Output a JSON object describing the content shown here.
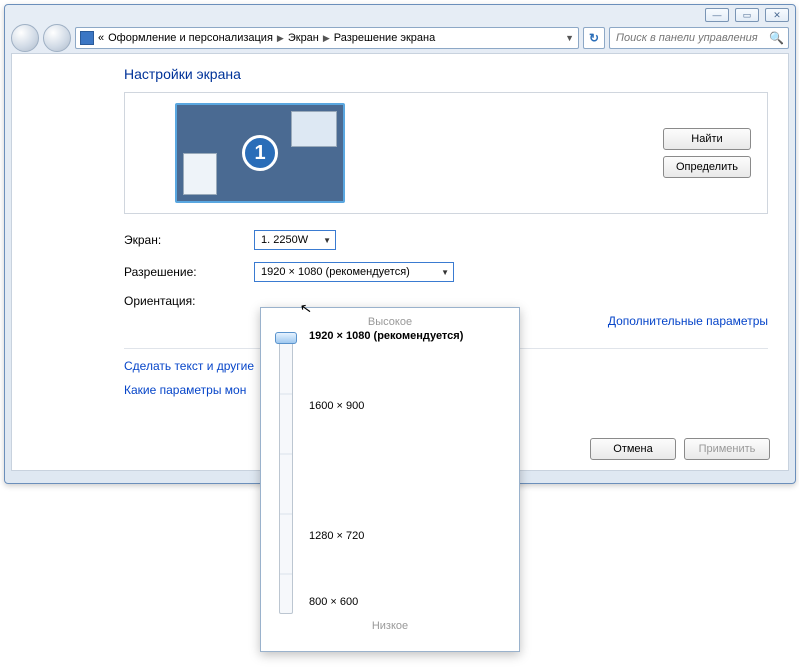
{
  "window": {
    "breadcrumb_prefix": "«",
    "breadcrumbs": [
      "Оформление и персонализация",
      "Экран",
      "Разрешение экрана"
    ],
    "search_placeholder": "Поиск в панели управления"
  },
  "page": {
    "title": "Настройки экрана",
    "monitor_number": "1",
    "find_btn": "Найти",
    "identify_btn": "Определить",
    "screen_label": "Экран:",
    "screen_value": "1. 2250W",
    "resolution_label": "Разрешение:",
    "resolution_value": "1920 × 1080 (рекомендуется)",
    "orientation_label": "Ориентация:",
    "advanced_link": "Дополнительные параметры",
    "text_link": "Сделать текст и другие",
    "help_link": "Какие параметры мон",
    "cancel_btn": "Отмена",
    "apply_btn": "Применить"
  },
  "resolution_popup": {
    "high_label": "Высокое",
    "low_label": "Низкое",
    "options": [
      "1920 × 1080 (рекомендуется)",
      "1600 × 900",
      "1280 × 720",
      "800 × 600"
    ]
  }
}
